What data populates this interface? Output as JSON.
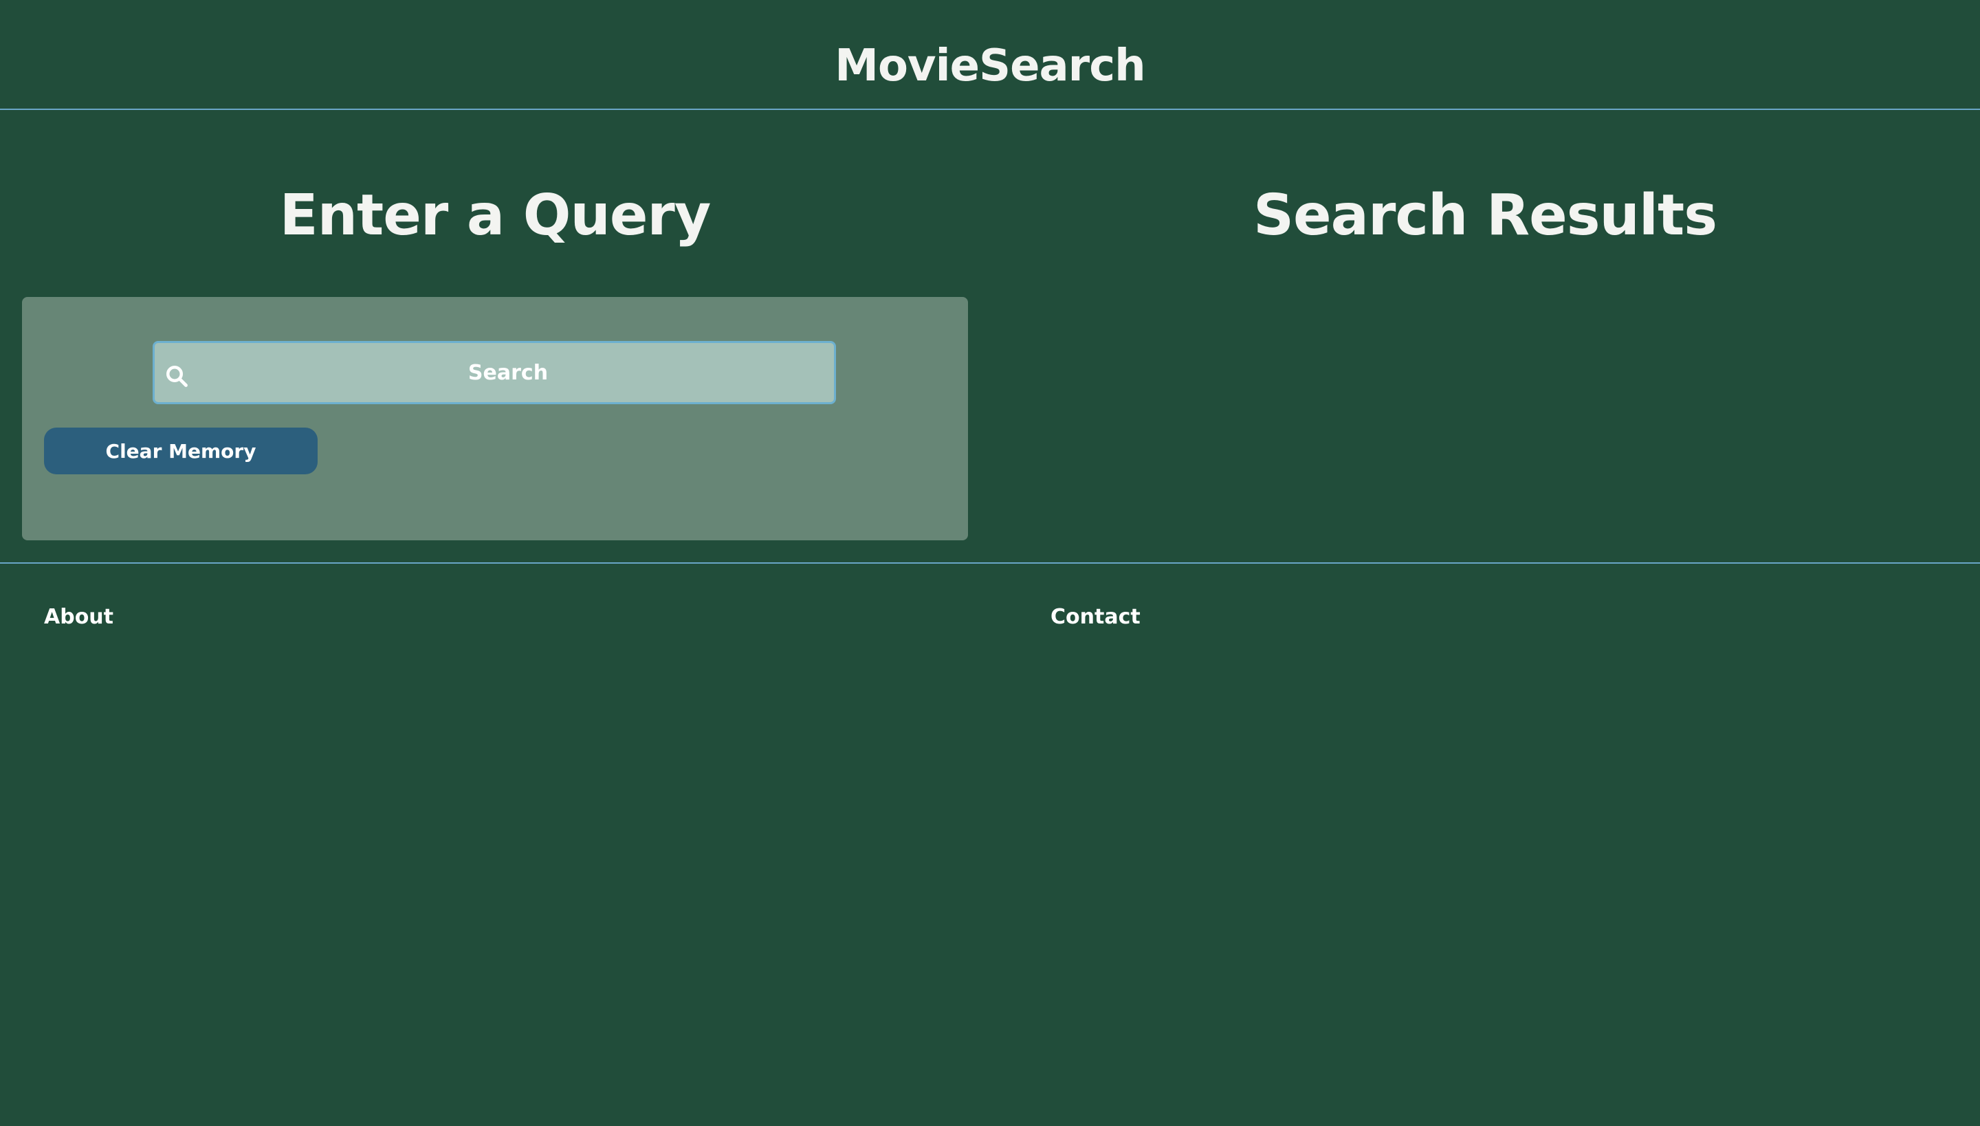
{
  "header": {
    "app_title": "MovieSearch"
  },
  "query_section": {
    "heading": "Enter a Query",
    "search": {
      "placeholder": "Search",
      "value": "",
      "icon": "search-icon"
    },
    "clear_button_label": "Clear Memory"
  },
  "results_section": {
    "heading": "Search Results",
    "results": []
  },
  "footer": {
    "about_label": "About",
    "contact_label": "Contact"
  },
  "colors": {
    "background": "#214d3a",
    "panel": "#678676",
    "search_field": "#a4c1b8",
    "accent_border": "#6aa6c7",
    "button": "#2c5f7d",
    "text": "#f3f4f1"
  }
}
